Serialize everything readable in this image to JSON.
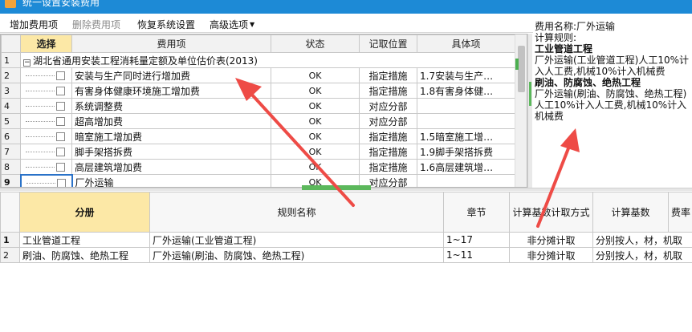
{
  "window": {
    "title": "统一设置安装费用"
  },
  "menu": {
    "add": "增加费用项",
    "delete": "删除费用项",
    "restore": "恢复系统设置",
    "advanced": "高级选项"
  },
  "fee_table": {
    "headers": {
      "select": "选择",
      "fee_item": "费用项",
      "status": "状态",
      "location": "记取位置",
      "detail": "具体项"
    },
    "group": {
      "num": "1",
      "toggle": "−",
      "label": "湖北省通用安装工程消耗量定额及单位估价表(2013)"
    },
    "rows": [
      {
        "num": "2",
        "name": "安装与生产同时进行增加费",
        "status": "OK",
        "location": "指定措施",
        "detail": "1.7安装与生产…"
      },
      {
        "num": "3",
        "name": "有害身体健康环境施工增加费",
        "status": "OK",
        "location": "指定措施",
        "detail": "1.8有害身体健…"
      },
      {
        "num": "4",
        "name": "系统调整费",
        "status": "OK",
        "location": "对应分部",
        "detail": ""
      },
      {
        "num": "5",
        "name": "超高增加费",
        "status": "OK",
        "location": "对应分部",
        "detail": ""
      },
      {
        "num": "6",
        "name": "暗室施工增加费",
        "status": "OK",
        "location": "指定措施",
        "detail": "1.5暗室施工增…"
      },
      {
        "num": "7",
        "name": "脚手架搭拆费",
        "status": "OK",
        "location": "指定措施",
        "detail": "1.9脚手架搭拆费"
      },
      {
        "num": "8",
        "name": "高层建筑增加费",
        "status": "OK",
        "location": "指定措施",
        "detail": "1.6高层建筑增…"
      },
      {
        "num": "9",
        "name": "厂外运输",
        "status": "OK",
        "location": "对应分部",
        "detail": ""
      }
    ]
  },
  "detail_panel": {
    "fee_name": "费用名称:厂外运输",
    "rule_label": "计算规则:",
    "section1_title": "工业管道工程",
    "section1_text": "厂外运输(工业管道工程)人工10%计入人工费,机械10%计入机械费",
    "section2_title": "刷油、防腐蚀、绝热工程",
    "section2_text": "厂外运输(刷油、防腐蚀、绝热工程)人工10%计入人工费,机械10%计入机械费"
  },
  "rules_table": {
    "headers": {
      "division": "分册",
      "rule_name": "规则名称",
      "chapter": "章节",
      "calc_method": "计算基数计取方式",
      "calc_base": "计算基数",
      "rate": "费率"
    },
    "rows": [
      {
        "num": "1",
        "division": "工业管道工程",
        "rule_name": "厂外运输(工业管道工程)",
        "chapter": "1~17",
        "calc_method": "非分摊计取",
        "calc_base": "分别按人，材，机取"
      },
      {
        "num": "2",
        "division": "刷油、防腐蚀、绝热工程",
        "rule_name": "厂外运输(刷油、防腐蚀、绝热工程)",
        "chapter": "1~11",
        "calc_method": "非分摊计取",
        "calc_base": "分别按人，材，机取"
      }
    ]
  },
  "colors": {
    "titlebar": "#1d8ad6",
    "header_highlight": "#fce8a6",
    "arrow": "#ee4b46",
    "grip": "#5cb85c"
  }
}
